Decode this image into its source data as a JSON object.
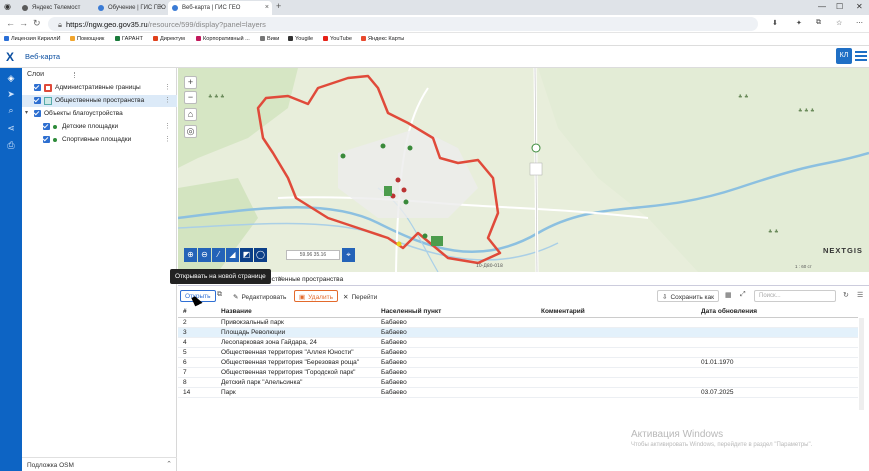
{
  "browser": {
    "tabs": [
      {
        "title": "Яндекс Телемост",
        "active": false
      },
      {
        "title": "Обучение | ГИС ГЕО",
        "active": false
      },
      {
        "title": "Веб-карта | ГИС ГЕО",
        "active": true
      }
    ],
    "url_host": "https://ngw.geo.gov35.ru",
    "url_path": "/resource/599/display?panel=layers",
    "bookmarks": [
      {
        "label": "Лицензия КириллИ",
        "color": "#2b6fd6"
      },
      {
        "label": "Помощник",
        "color": "#f1a52c"
      },
      {
        "label": "ГАРАНТ",
        "color": "#1a7a3a"
      },
      {
        "label": "Директум",
        "color": "#e0401b"
      },
      {
        "label": "Корпоративный ...",
        "color": "#c2185b"
      },
      {
        "label": "Вики",
        "color": "#777777"
      },
      {
        "label": "Yougile",
        "color": "#333333"
      },
      {
        "label": "YouTube",
        "color": "#e62117"
      },
      {
        "label": "Яндекс Карты",
        "color": "#e8492d"
      }
    ]
  },
  "app": {
    "logo": "X",
    "title": "Веб-карта",
    "user_initials": "КЛ"
  },
  "layers": {
    "header": "Слои",
    "items": [
      {
        "label": "Административные границы",
        "level": 0,
        "checked": true,
        "symbol": "boundary",
        "selected": false
      },
      {
        "label": "Общественные пространства",
        "level": 0,
        "checked": true,
        "symbol": "area",
        "selected": true
      },
      {
        "label": "Объекты благоустройства",
        "level": 0,
        "checked": true,
        "symbol": "group",
        "selected": false
      },
      {
        "label": "Детские площадки",
        "level": 1,
        "checked": true,
        "symbol": "dot",
        "selected": false
      },
      {
        "label": "Спортивные площадки",
        "level": 1,
        "checked": true,
        "symbol": "dot",
        "selected": false
      }
    ],
    "basemap_label": "Подложка OSM"
  },
  "map": {
    "coordinates": "59.96 35.16",
    "brand": "NEXTGIS",
    "scale_text": "1 : 60 ст",
    "road_label": "10-Д80-018"
  },
  "tooltip": "Открывать на новой странице",
  "table": {
    "tab_title": "Общественные пространства",
    "toolbar": {
      "open": "Открыть",
      "edit": "Редактировать",
      "delete": "Удалить",
      "goto": "Перейти",
      "save_as": "Сохранить как",
      "search_placeholder": "Поиск..."
    },
    "columns": [
      "#",
      "Название",
      "Населенный пункт",
      "Комментарий",
      "Дата обновления"
    ],
    "rows": [
      {
        "id": "2",
        "name": "Привокзальный парк",
        "town": "Бабаево",
        "comment": "",
        "date": ""
      },
      {
        "id": "3",
        "name": "Площадь Революции",
        "town": "Бабаево",
        "comment": "",
        "date": ""
      },
      {
        "id": "4",
        "name": "Лесопарковая зона Гайдара, 24",
        "town": "Бабаево",
        "comment": "",
        "date": ""
      },
      {
        "id": "5",
        "name": "Общественная территория \"Аллея Юности\"",
        "town": "Бабаево",
        "comment": "",
        "date": ""
      },
      {
        "id": "6",
        "name": "Общественная территория \"Березовая роща\"",
        "town": "Бабаево",
        "comment": "",
        "date": "01.01.1970"
      },
      {
        "id": "7",
        "name": "Общественная территория \"Городской парк\"",
        "town": "Бабаево",
        "comment": "",
        "date": ""
      },
      {
        "id": "8",
        "name": "Детский парк \"Апельсинка\"",
        "town": "Бабаево",
        "comment": "",
        "date": ""
      },
      {
        "id": "14",
        "name": "Парк",
        "town": "Бабаево",
        "comment": "",
        "date": "03.07.2025"
      }
    ],
    "selected_row_id": "3"
  },
  "watermark": {
    "title": "Активация Windows",
    "subtitle": "Чтобы активировать Windows, перейдите в раздел \"Параметры\"."
  },
  "colors": {
    "brand_blue": "#0d64c4",
    "boundary_red": "#e04a3a",
    "delete_orange": "#e36a2c",
    "selected_row": "#e3f1fb"
  }
}
